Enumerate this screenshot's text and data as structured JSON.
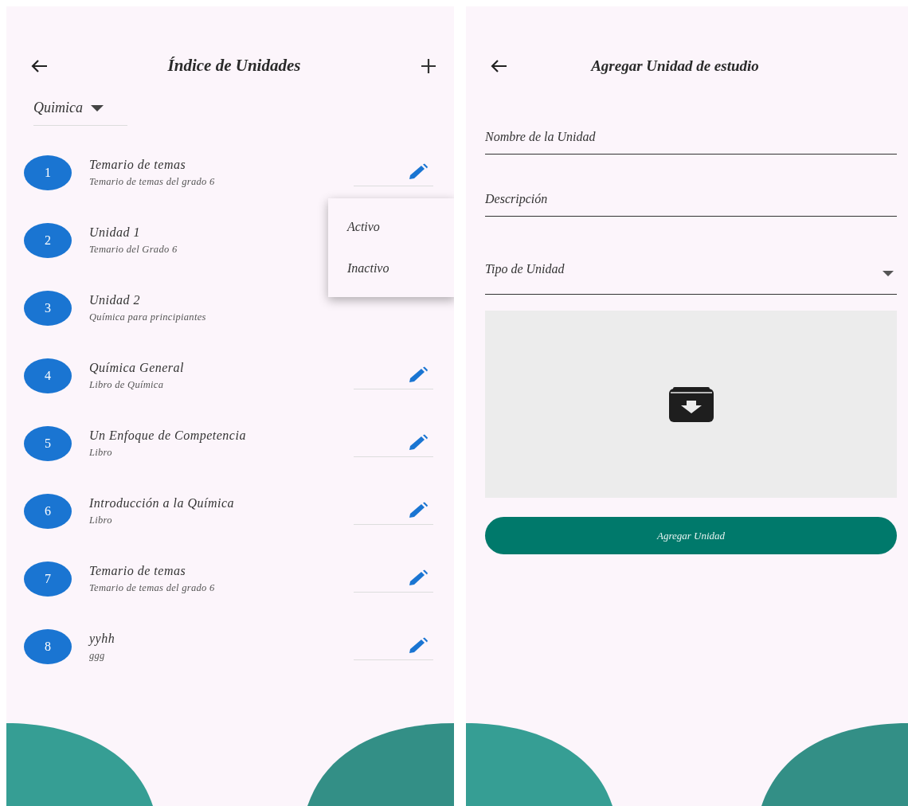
{
  "list_screen": {
    "title": "Índice de Unidades",
    "filter": {
      "value": "Quimica"
    },
    "units": [
      {
        "number": "1",
        "title": "Temario de temas",
        "subtitle": "Temario de temas del grado 6",
        "menu_open": false
      },
      {
        "number": "2",
        "title": "Unidad 1",
        "subtitle": "Temario del Grado 6",
        "menu_open": true
      },
      {
        "number": "3",
        "title": "Unidad 2",
        "subtitle": "Química para principiantes",
        "menu_open": false
      },
      {
        "number": "4",
        "title": "Química General",
        "subtitle": "Libro de Química",
        "menu_open": false
      },
      {
        "number": "5",
        "title": "Un Enfoque de Competencia",
        "subtitle": "Libro",
        "menu_open": false
      },
      {
        "number": "6",
        "title": "Introducción a la Química",
        "subtitle": "Libro",
        "menu_open": false
      },
      {
        "number": "7",
        "title": "Temario de temas",
        "subtitle": "Temario de temas del grado 6",
        "menu_open": false
      },
      {
        "number": "8",
        "title": "yyhh",
        "subtitle": "ggg",
        "menu_open": false
      }
    ],
    "menu_items": [
      "Activo",
      "Inactivo"
    ]
  },
  "form_screen": {
    "title": "Agregar Unidad de estudio",
    "fields": [
      {
        "kind": "text",
        "placeholder": "Nombre de la Unidad"
      },
      {
        "kind": "text",
        "placeholder": "Descripción"
      },
      {
        "kind": "select",
        "placeholder": "Tipo de Unidad"
      }
    ],
    "submit": "Agregar Unidad"
  }
}
